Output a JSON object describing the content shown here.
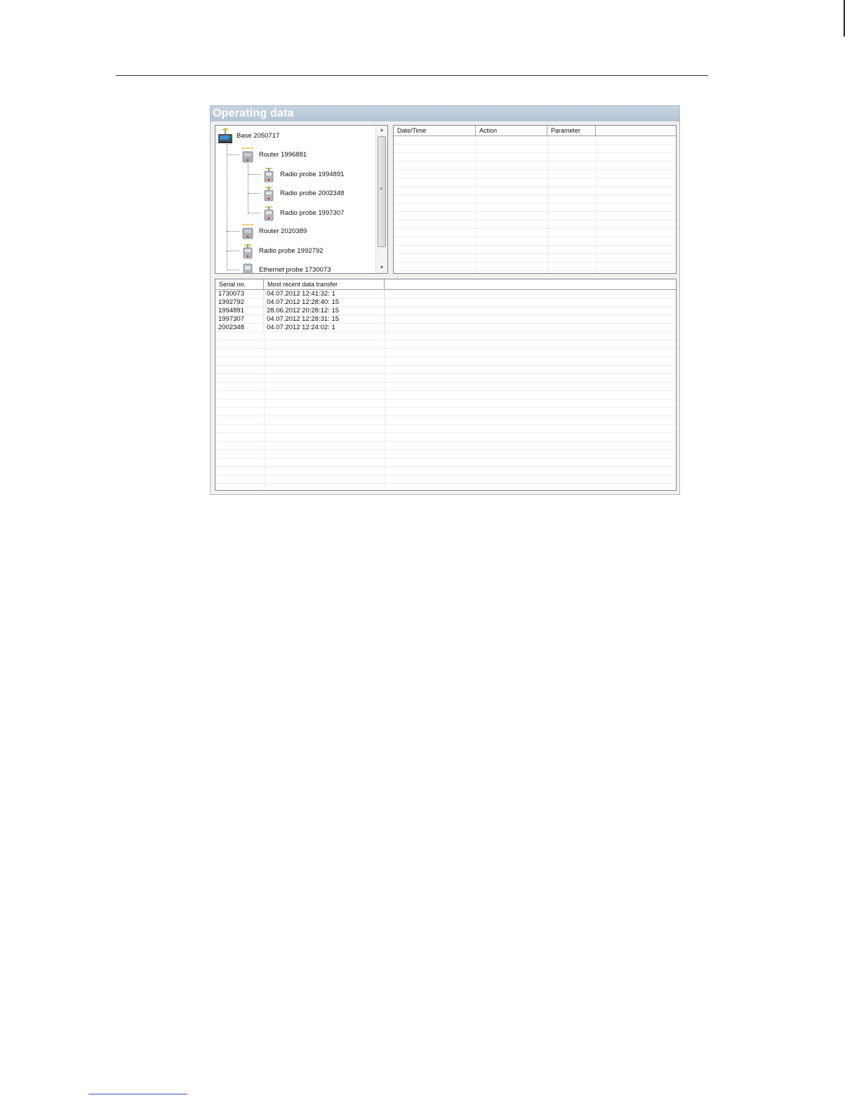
{
  "window": {
    "title": "Operating data"
  },
  "tree": {
    "items": [
      {
        "label": "Base 2050717",
        "icon": "base-station-icon"
      },
      {
        "label": "Router 1996881",
        "icon": "router-icon"
      },
      {
        "label": "Radio probe 1994891",
        "icon": "radio-probe-icon"
      },
      {
        "label": "Radio probe 2002348",
        "icon": "radio-probe-icon"
      },
      {
        "label": "Radio probe 1997307",
        "icon": "radio-probe-icon"
      },
      {
        "label": "Router 2020389",
        "icon": "router-icon"
      },
      {
        "label": "Radio probe 1992792",
        "icon": "radio-probe-icon"
      },
      {
        "label": "Ethernet probe 1730073",
        "icon": "ethernet-probe-icon"
      }
    ]
  },
  "events_table": {
    "columns": [
      "Date/Time",
      "Action",
      "Parameter",
      ""
    ],
    "rows": []
  },
  "transfer_table": {
    "columns": [
      "Serial no.",
      "Most recent data transfer",
      ""
    ],
    "rows": [
      [
        "1730073",
        "04.07.2012 12:41:32: 1"
      ],
      [
        "1992792",
        "04.07.2012 12:28:40: 15"
      ],
      [
        "1994891",
        "28.06.2012 20:28:12: 15"
      ],
      [
        "1997307",
        "04.07.2012 12:28:31: 15"
      ],
      [
        "2002348",
        "04.07.2012 12:24:02: 1"
      ]
    ]
  },
  "colors": {
    "title_bar": "#b4c4d6",
    "device_body": "#a9aeb3",
    "signal": "#d9a400",
    "status_led": "#d02020"
  }
}
